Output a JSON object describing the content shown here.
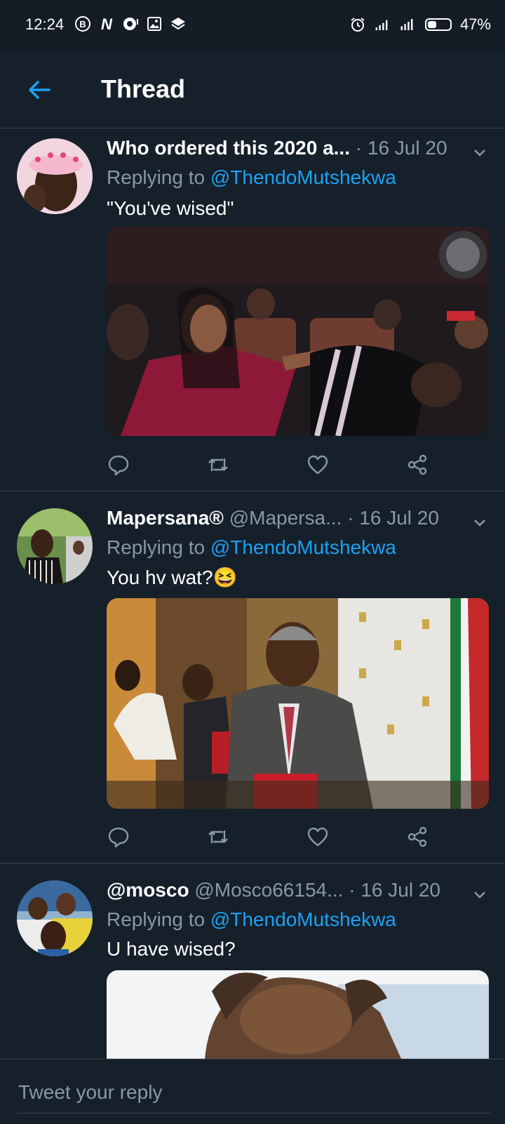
{
  "status_bar": {
    "time": "12:24",
    "battery": "47%",
    "battery_level": 0.47
  },
  "header": {
    "title": "Thread"
  },
  "tweets": [
    {
      "name": "Who ordered this 2020 a...",
      "handle": "",
      "dot": "·",
      "date": "16 Jul 20",
      "replying_prefix": "Replying to ",
      "replying_to": "@ThendoMutshekwa",
      "text": "\"You've wised\""
    },
    {
      "name": "Mapersana®",
      "handle": "@Mapersa...",
      "dot": "·",
      "date": "16 Jul 20",
      "replying_prefix": "Replying to ",
      "replying_to": "@ThendoMutshekwa",
      "text": "You hv wat?😆"
    },
    {
      "name": "@mosco",
      "handle": "@Mosco66154...",
      "dot": "·",
      "date": "16 Jul 20",
      "replying_prefix": "Replying to ",
      "replying_to": "@ThendoMutshekwa",
      "text": "U have wised?"
    }
  ],
  "reply_box": {
    "placeholder": "Tweet your reply"
  },
  "colors": {
    "background": "#15202b",
    "accent": "#1da1f2",
    "secondary_text": "#8899a6",
    "divider": "#38444d"
  }
}
